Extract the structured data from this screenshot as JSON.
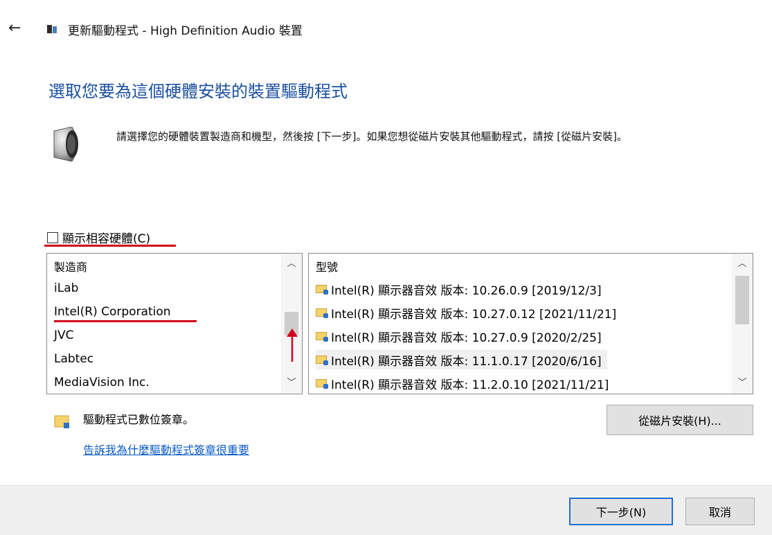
{
  "window": {
    "title": "更新驅動程式 - High Definition Audio 裝置",
    "back_icon": "back-arrow-icon",
    "app_icon": "device-manager-icon"
  },
  "heading": "選取您要為這個硬體安裝的裝置驅動程式",
  "instruction": "請選擇您的硬體裝置製造商和機型，然後按 [下一步]。如果您想從磁片安裝其他驅動程式，請按 [從磁片安裝]。",
  "show_compatible": {
    "label": "顯示相容硬體(C)",
    "checked": false
  },
  "manufacturers": {
    "header": "製造商",
    "items": [
      "iLab",
      "Intel(R) Corporation",
      "JVC",
      "Labtec",
      "MediaVision Inc."
    ],
    "selected": "Intel(R) Corporation"
  },
  "models": {
    "header": "型號",
    "items": [
      "Intel(R) 顯示器音效 版本: 10.26.0.9 [2019/12/3]",
      "Intel(R) 顯示器音效 版本: 10.27.0.12 [2021/11/21]",
      "Intel(R) 顯示器音效 版本: 10.27.0.9 [2020/2/25]",
      "Intel(R) 顯示器音效 版本: 11.1.0.17 [2020/6/16]",
      "Intel(R) 顯示器音效 版本: 11.2.0.10 [2021/11/21]"
    ],
    "selected_index": 3
  },
  "signed_text": "驅動程式已數位簽章。",
  "info_link": "告訴我為什麼驅動程式簽章很重要",
  "buttons": {
    "have_disk": "從磁片安裝(H)...",
    "next": "下一步(N)",
    "cancel": "取消"
  },
  "colors": {
    "accent": "#1f6fd1",
    "heading": "#1a4fa0",
    "annotation_red": "#d0021b"
  }
}
